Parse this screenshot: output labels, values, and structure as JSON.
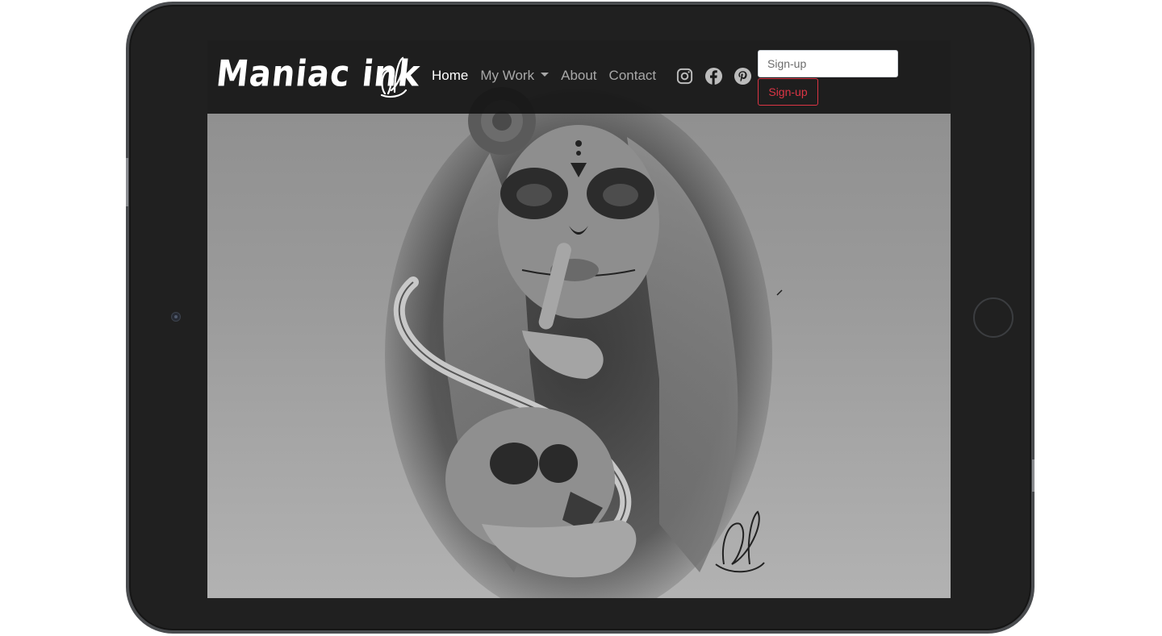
{
  "brand": {
    "name": "Maniac ink"
  },
  "nav": {
    "items": [
      {
        "label": "Home",
        "active": true
      },
      {
        "label": "My Work",
        "dropdown": true
      },
      {
        "label": "About"
      },
      {
        "label": "Contact"
      }
    ]
  },
  "social": [
    "instagram-icon",
    "facebook-icon",
    "pinterest-icon"
  ],
  "signup": {
    "placeholder": "Sign-up",
    "button_label": "Sign-up"
  },
  "colors": {
    "navbar": "#161616",
    "accent": "#dc3545",
    "tablet": "#202020"
  }
}
